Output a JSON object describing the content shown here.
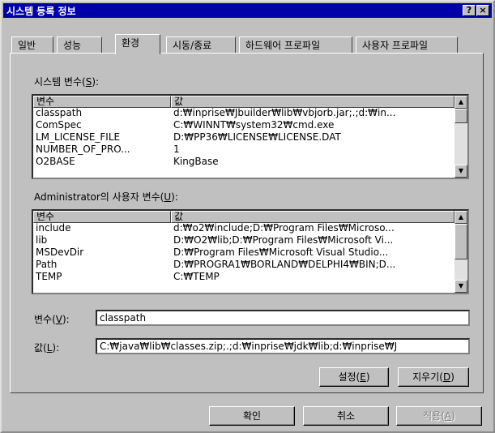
{
  "window": {
    "title": "시스템 등록 정보",
    "help_glyph": "?",
    "close_glyph": "×"
  },
  "tabs": [
    "일반",
    "성능",
    "환경",
    "시동/종료",
    "하드웨어 프로파일",
    "사용자 프로파일"
  ],
  "active_tab": "환경",
  "system_vars": {
    "label_prefix": "시스템 변수(",
    "label_key": "S",
    "label_suffix": "):",
    "col_name": "변수",
    "col_value": "값",
    "rows": [
      {
        "name": "classpath",
        "value": "d:₩inprise₩Jbuilder₩lib₩vbjorb.jar;.;d:₩in..."
      },
      {
        "name": "ComSpec",
        "value": "C:₩WINNT₩system32₩cmd.exe"
      },
      {
        "name": "LM_LICENSE_FILE",
        "value": "D:₩PP36₩LICENSE₩LICENSE.DAT"
      },
      {
        "name": "NUMBER_OF_PRO...",
        "value": "1"
      },
      {
        "name": "O2BASE",
        "value": "KingBase"
      }
    ]
  },
  "user_vars": {
    "label_prefix": "Administrator의 사용자 변수(",
    "label_key": "U",
    "label_suffix": "):",
    "col_name": "변수",
    "col_value": "값",
    "rows": [
      {
        "name": "include",
        "value": "d:₩o2₩include;D:₩Program Files₩Microso..."
      },
      {
        "name": "lib",
        "value": "D:₩O2₩lib;D:₩Program Files₩Microsoft Vi..."
      },
      {
        "name": "MSDevDir",
        "value": "D:₩Program Files₩Microsoft Visual Studio..."
      },
      {
        "name": "Path",
        "value": "D:₩PROGRA1₩BORLAND₩DELPHI4₩BIN;D..."
      },
      {
        "name": "TEMP",
        "value": "C:₩TEMP"
      }
    ]
  },
  "variable_field": {
    "label_prefix": "변수(",
    "label_key": "V",
    "label_suffix": "):",
    "value": "classpath"
  },
  "value_field": {
    "label_prefix": "값(",
    "label_key": "L",
    "label_suffix": "):",
    "value": "C:₩java₩lib₩classes.zip;.;d:₩inprise₩jdk₩lib;d:₩inprise₩J"
  },
  "buttons": {
    "set": {
      "prefix": "설정(",
      "key": "E",
      "suffix": ")"
    },
    "delete": {
      "prefix": "지우기(",
      "key": "D",
      "suffix": ")"
    },
    "ok": "확인",
    "cancel": "취소",
    "apply": {
      "prefix": "적용(",
      "key": "A",
      "suffix": ")"
    }
  },
  "scroll_glyphs": {
    "up": "▲",
    "down": "▼"
  }
}
